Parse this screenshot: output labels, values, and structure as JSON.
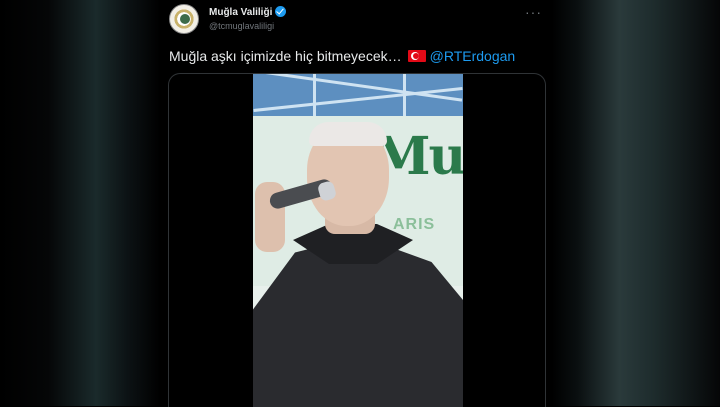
{
  "tweet": {
    "author_name": "Muğla Valiliği",
    "handle": "@tcmuglavaliligi",
    "text": "Muğla aşkı içimizde hiç bitmeyecek…",
    "mention": "@RTErdogan",
    "flag_icon": "turkey-flag-icon"
  },
  "video_banner": {
    "big_text": "Mu",
    "sub_text": "ARIS"
  },
  "colors": {
    "accent": "#1d9bf0",
    "background": "#000000",
    "text": "#e7e9ea",
    "muted": "#71767b"
  }
}
